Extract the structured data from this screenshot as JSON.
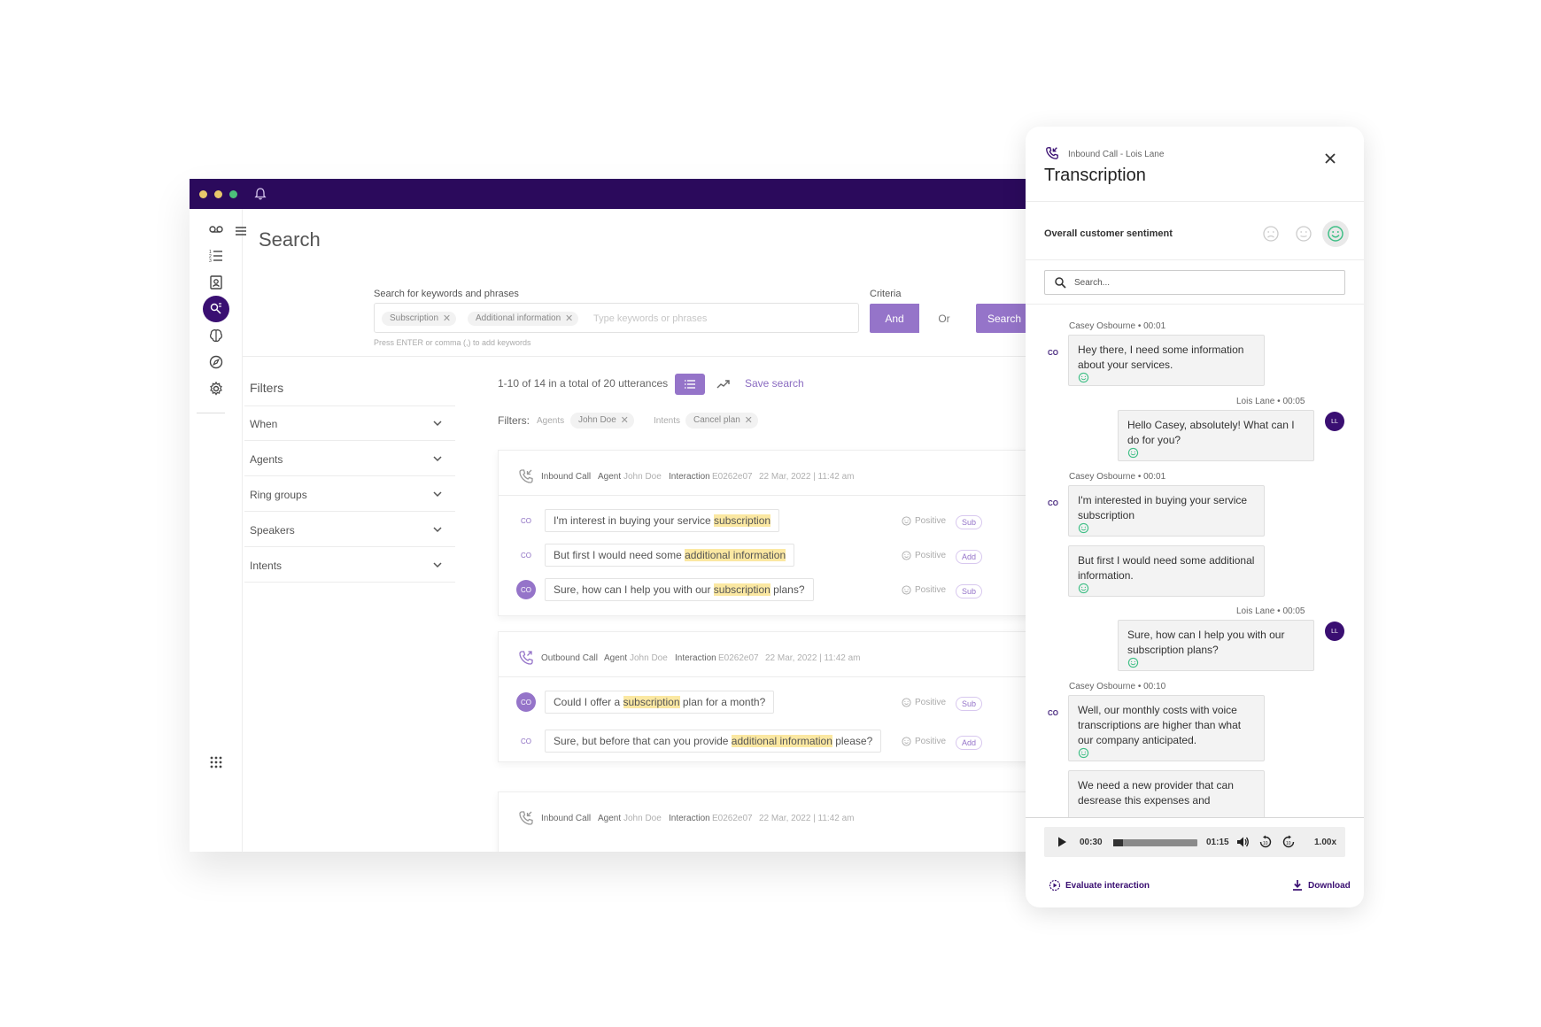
{
  "search_page": {
    "title": "Search",
    "search_label": "Search for keywords and phrases",
    "chips": [
      "Subscription",
      "Additional information"
    ],
    "placeholder": "Type keywords or phrases",
    "hint": "Press ENTER or comma (,) to add keywords",
    "criteria_label": "Criteria",
    "and_label": "And",
    "or_label": "Or",
    "search_button": "Search"
  },
  "filters": {
    "title": "Filters",
    "items": [
      "When",
      "Agents",
      "Ring groups",
      "Speakers",
      "Intents"
    ]
  },
  "results": {
    "count": "1-10 of 14 in a total of 20 utterances",
    "save_search": "Save search",
    "filters_label": "Filters:",
    "active_filters": [
      {
        "key": "Agents",
        "value": "John Doe"
      },
      {
        "key": "Intents",
        "value": "Cancel plan"
      }
    ]
  },
  "cards": [
    {
      "call_type": "Inbound Call",
      "agent_label": "Agent",
      "agent": "John Doe",
      "interaction_label": "Interaction",
      "interaction_id": "E0262e07",
      "date": "22 Mar, 2022 | 11:42 am",
      "utterances": [
        {
          "avatar": "CO",
          "pre": "I'm interest in buying your service ",
          "hl": "subscription",
          "post": "",
          "sentiment": "Positive",
          "tag": "Sub"
        },
        {
          "avatar": "CO",
          "pre": "But first I would need some ",
          "hl": "additional information",
          "post": "",
          "sentiment": "Positive",
          "tag": "Add"
        },
        {
          "avatar": "CO",
          "pre": "Sure, how can I help you with our ",
          "hl": "subscription",
          "post": " plans?",
          "sentiment": "Positive",
          "tag": "Sub"
        }
      ]
    },
    {
      "call_type": "Outbound Call",
      "agent_label": "Agent",
      "agent": "John Doe",
      "interaction_label": "Interaction",
      "interaction_id": "E0262e07",
      "date": "22 Mar, 2022 | 11:42 am",
      "utterances": [
        {
          "avatar": "CO",
          "pre": "Could I offer a ",
          "hl": "subscription",
          "post": " plan for a month?",
          "sentiment": "Positive",
          "tag": "Sub"
        },
        {
          "avatar": "CO",
          "pre": "Sure, but before that can you provide ",
          "hl": "additional information",
          "post": " please?",
          "sentiment": "Positive",
          "tag": "Add"
        }
      ]
    },
    {
      "call_type": "Inbound Call",
      "agent_label": "Agent",
      "agent": "John Doe",
      "interaction_label": "Interaction",
      "interaction_id": "E0262e07",
      "date": "22 Mar, 2022 | 11:42 am",
      "utterances": []
    }
  ],
  "transcription": {
    "subtitle": "Inbound Call - Lois Lane",
    "title": "Transcription",
    "sentiment_label": "Overall customer sentiment",
    "search_placeholder": "Search...",
    "messages": [
      {
        "speaker": "Casey Osbourne",
        "time": "00:01",
        "side": "left",
        "avatar": "CO",
        "text": "Hey there, I need some information about your services."
      },
      {
        "speaker": "Lois Lane",
        "time": "00:05",
        "side": "right",
        "avatar": "LL",
        "text": "Hello Casey, absolutely! What can I do for you?"
      },
      {
        "speaker": "Casey Osbourne",
        "time": "00:01",
        "side": "left",
        "avatar": "CO",
        "text": "I'm interested in buying your service subscription"
      },
      {
        "speaker": "",
        "time": "",
        "side": "left",
        "avatar": "",
        "text": "But first I would need some additional information."
      },
      {
        "speaker": "Lois Lane",
        "time": "00:05",
        "side": "right",
        "avatar": "LL",
        "text": "Sure, how can I help you with our subscription plans?"
      },
      {
        "speaker": "Casey Osbourne",
        "time": "00:10",
        "side": "left",
        "avatar": "CO",
        "text": "Well, our monthly costs with voice transcriptions are higher than what our company anticipated."
      },
      {
        "speaker": "",
        "time": "",
        "side": "left",
        "avatar": "",
        "text": "We need a new provider that can desrease this expenses and"
      }
    ],
    "player": {
      "current": "00:30",
      "duration": "01:15",
      "speed": "1.00x",
      "progress": 0.12
    },
    "evaluate_label": "Evaluate interaction",
    "download_label": "Download"
  },
  "colors": {
    "brand": "#2b0a5c",
    "accent": "#9574c9",
    "highlight": "#fbe8a2",
    "positive": "#3fbf86"
  }
}
